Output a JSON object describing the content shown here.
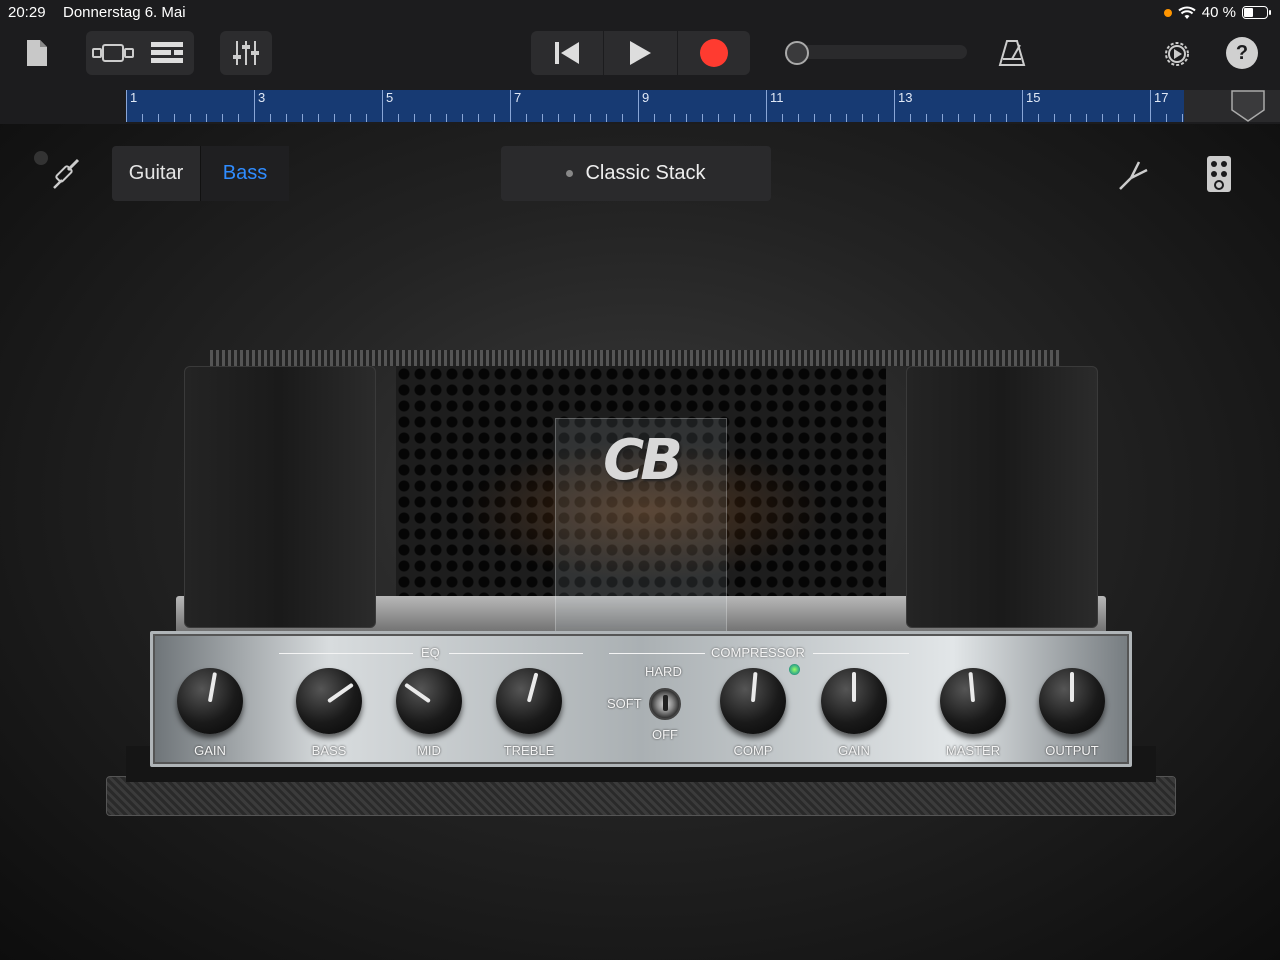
{
  "status": {
    "time": "20:29",
    "date": "Donnerstag 6. Mai",
    "battery": "40 %",
    "battery_level": 0.4
  },
  "ruler": {
    "bars": [
      "1",
      "3",
      "5",
      "7",
      "9",
      "11",
      "13",
      "15",
      "17"
    ]
  },
  "header": {
    "instruments": {
      "guitar": "Guitar",
      "bass": "Bass"
    },
    "preset": "Classic Stack"
  },
  "amp": {
    "logo": "CB",
    "sections": {
      "eq": "EQ",
      "compressor": "COMPRESSOR"
    },
    "knobs": [
      {
        "label": "GAIN",
        "angle": 10
      },
      {
        "label": "BASS",
        "angle": 55
      },
      {
        "label": "MID",
        "angle": -55
      },
      {
        "label": "TREBLE",
        "angle": 15
      },
      {
        "label": "COMP",
        "angle": 5
      },
      {
        "label": "GAIN",
        "angle": 0
      },
      {
        "label": "MASTER",
        "angle": -5
      },
      {
        "label": "OUTPUT",
        "angle": 0
      }
    ],
    "switch": {
      "hard": "HARD",
      "soft": "SOFT",
      "off": "OFF"
    }
  },
  "colors": {
    "accent": "#2f8cff",
    "record": "#ff3b30",
    "ruler": "#173a73"
  }
}
